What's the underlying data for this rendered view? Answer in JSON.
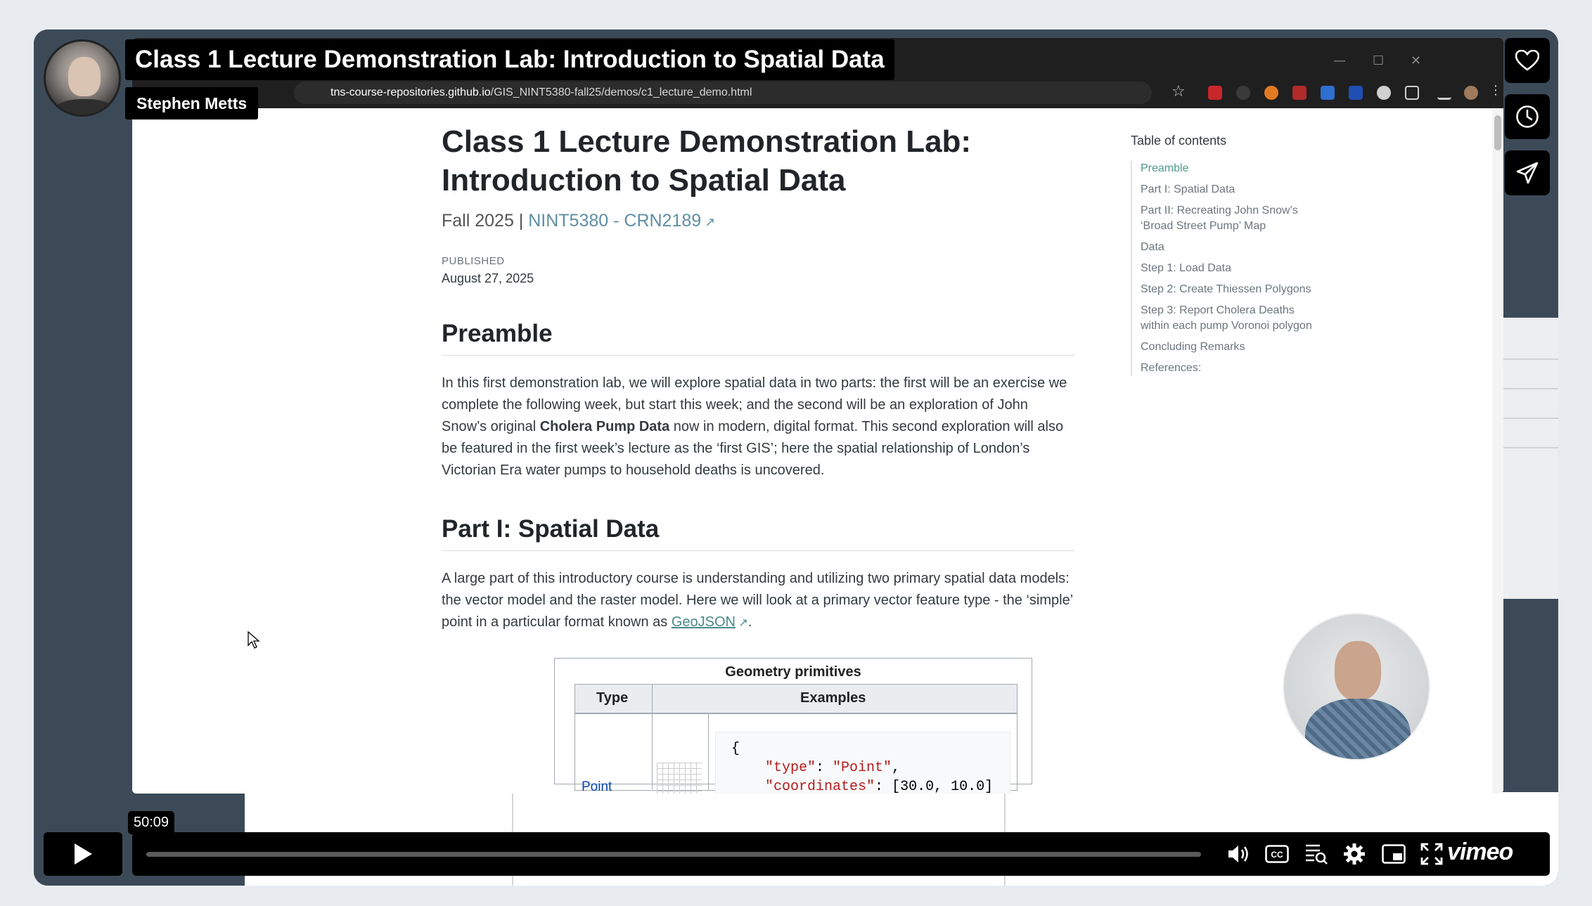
{
  "video": {
    "title": "Class 1 Lecture Demonstration Lab: Introduction to Spatial Data",
    "author": "Stephen Metts",
    "timestamp": "50:09",
    "brand": "vimeo"
  },
  "browser": {
    "url_host": "tns-course-repositories.github.io",
    "url_path": "/GIS_NINT5380-fall25/demos/c1_lecture_demo.html"
  },
  "page": {
    "title": "Class 1 Lecture Demonstration Lab: Introduction to Spatial Data",
    "subtitle_prefix": "Fall 2025 | ",
    "subtitle_link": "NINT5380 - CRN2189",
    "published_label": "PUBLISHED",
    "published_date": "August 27, 2025",
    "preamble_heading": "Preamble",
    "preamble_text_1": "In this first demonstration lab, we will explore spatial data in two parts: the first will be an exercise we complete the following week, but start this week; and the second will be an exploration of John Snow’s original ",
    "preamble_bold": "Cholera Pump Data",
    "preamble_text_2": " now in modern, digital format. This second exploration will also be featured in the first week’s lecture as the ‘first GIS’; here the spatial relationship of London’s Victorian Era water pumps to household deaths is uncovered.",
    "part1_heading": "Part I: Spatial Data",
    "part1_text": "A large part of this introductory course is understanding and utilizing two primary spatial data models: the vector model and the raster model. Here we will look at a primary vector feature type - the ‘simple’ point in a particular format known as ",
    "part1_link": "GeoJSON",
    "part1_end": "."
  },
  "toc": {
    "title": "Table of contents",
    "items": [
      "Preamble",
      "Part I: Spatial Data",
      "Part II: Recreating John Snow’s ‘Broad Street Pump’ Map",
      "Data",
      "Step 1: Load Data",
      "Step 2: Create Thiessen Polygons",
      "Step 3: Report Cholera Deaths within each pump Voronoi polygon",
      "Concluding Remarks",
      "References:"
    ]
  },
  "geometry_table": {
    "caption": "Geometry primitives",
    "col_type": "Type",
    "col_examples": "Examples",
    "row_type": "Point",
    "code_line1": "{",
    "code_key1": "\"type\"",
    "code_val1": "\"Point\"",
    "code_key2": "\"coordinates\"",
    "code_val2": "[30.0, 10.0]",
    "code_line4": "}"
  }
}
